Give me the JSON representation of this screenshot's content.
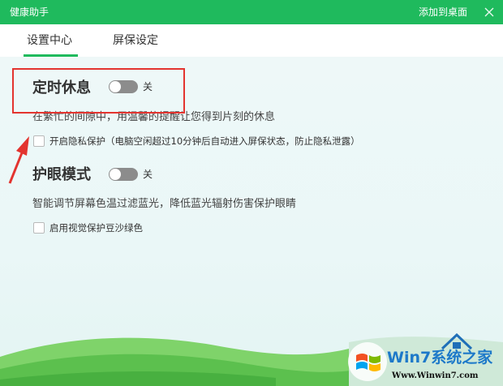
{
  "window": {
    "title": "健康助手",
    "add_to_desktop": "添加到桌面",
    "close_icon": "close-icon"
  },
  "tabs": [
    {
      "label": "设置中心",
      "active": true
    },
    {
      "label": "屏保设定",
      "active": false
    }
  ],
  "timed_rest": {
    "title": "定时休息",
    "toggle_state": "关",
    "description": "在繁忙的间隙中，用温馨的提醒让您得到片刻的休息",
    "privacy_option": "开启隐私保护（电脑空闲超过10分钟后自动进入屏保状态，防止隐私泄露）"
  },
  "eye_protection": {
    "title": "护眼模式",
    "toggle_state": "关",
    "description": "智能调节屏幕色温过滤蓝光，降低蓝光辐射伤害保护眼睛",
    "green_option": "启用视觉保护豆沙绿色"
  },
  "watermark": {
    "brand": "Win7系统之家",
    "url": "Www.Winwin7.com"
  },
  "colors": {
    "accent": "#1fba5d",
    "annotation": "#e3342f",
    "toggle_off": "#8c8c8c"
  }
}
